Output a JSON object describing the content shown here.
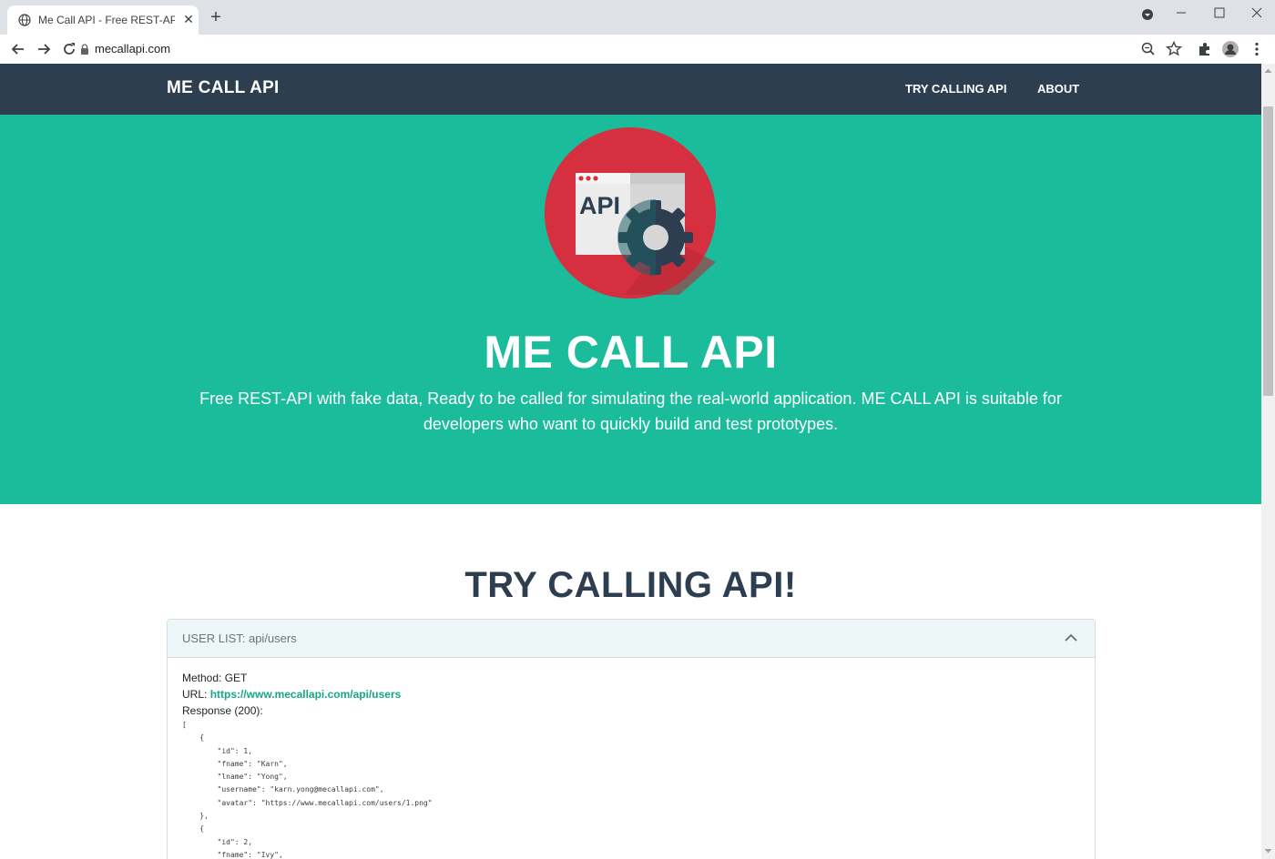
{
  "browser": {
    "tab_title": "Me Call API - Free REST-API, Rea",
    "tab_close": "✕",
    "new_tab": "+",
    "url": "mecallapi.com"
  },
  "nav": {
    "brand": "ME CALL API",
    "links": [
      "TRY CALLING API",
      "ABOUT"
    ]
  },
  "hero": {
    "logo_text": "API",
    "title": "ME CALL API",
    "description": "Free REST-API with fake data, Ready to be called for simulating the real-world application. ME CALL API is suitable for developers who want to quickly build and test prototypes."
  },
  "section": {
    "title": "TRY CALLING API!"
  },
  "accordion": {
    "header": "USER LIST: api/users",
    "method": "Method: GET",
    "url_label": "URL: ",
    "url_value": "https://www.mecallapi.com/api/users",
    "response_label": "Response (200):",
    "response_lines": [
      "[",
      "    {",
      "        \"id\": 1,",
      "        \"fname\": \"Karn\",",
      "        \"lname\": \"Yong\",",
      "        \"username\": \"karn.yong@mecallapi.com\",",
      "        \"avatar\": \"https://www.mecallapi.com/users/1.png\"",
      "    },",
      "    {",
      "        \"id\": 2,",
      "        \"fname\": \"Ivy\","
    ]
  },
  "colors": {
    "nav_bg": "#2c3e50",
    "hero_bg": "#1abc9c",
    "logo_circle": "#d63040",
    "link": "#18a689"
  }
}
